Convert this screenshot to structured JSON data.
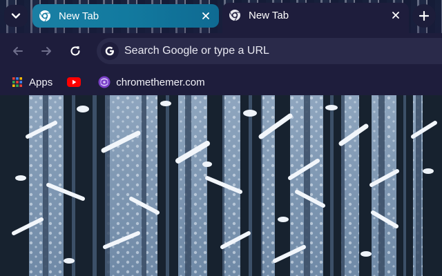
{
  "tab_strip": {
    "tab_search_icon": "chevron-down-icon",
    "tabs": [
      {
        "title": "New Tab",
        "favicon": "chrome-icon",
        "close_icon": "close-icon",
        "active": false
      },
      {
        "title": "New Tab",
        "favicon": "chrome-icon",
        "close_icon": "close-icon",
        "active": true
      }
    ],
    "new_tab_icon": "plus-icon"
  },
  "toolbar": {
    "back_icon": "arrow-left-icon",
    "forward_icon": "arrow-right-icon",
    "reload_icon": "reload-icon",
    "omnibox": {
      "icon": "google-g-icon",
      "placeholder": "Search Google or type a URL",
      "value": ""
    }
  },
  "bookmarks": {
    "items": [
      {
        "label": "Apps",
        "icon": "apps-grid-icon"
      },
      {
        "label": "",
        "icon": "youtube-icon"
      },
      {
        "label": "chromethemer.com",
        "icon": "chromethemer-icon"
      }
    ]
  },
  "colors": {
    "active_tab_bg": "#1e1d3c",
    "inactive_tab_bg": "#127a9f",
    "toolbar_bg": "#1e1d3c",
    "omnibox_bg": "#2a2a4a",
    "text": "#ffffff"
  },
  "background": {
    "description_icon": "snowy-forest-wallpaper"
  }
}
